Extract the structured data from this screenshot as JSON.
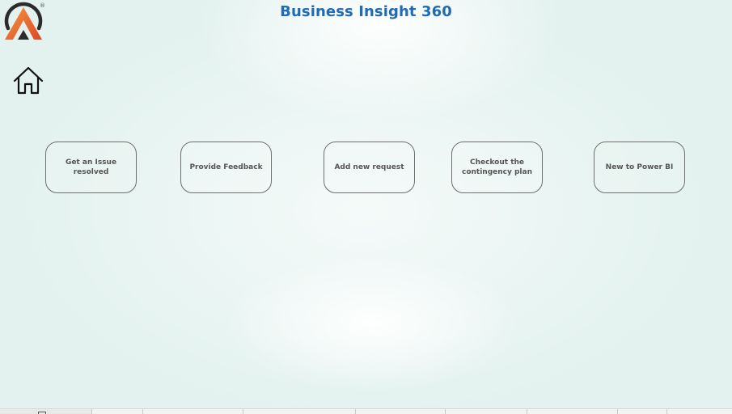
{
  "header": {
    "title": "Business Insight 360",
    "logo_icon": "atliq-logo-icon",
    "registered_mark": "®"
  },
  "nav": {
    "home_icon": "home-icon"
  },
  "actions": [
    {
      "label": "Get an Issue resolved"
    },
    {
      "label": "Provide Feedback"
    },
    {
      "label": "Add new request"
    },
    {
      "label": "Checkout the\ncontingency plan"
    },
    {
      "label": "New to Power BI"
    }
  ],
  "colors": {
    "title": "#1f6bb5",
    "logo_orange": "#e8652b",
    "logo_dark": "#2b2b2b",
    "background": "#e6f3f0",
    "button_border": "#6e6e6e",
    "button_text": "#555555"
  },
  "page_tabs": {
    "count": 8,
    "active_index": 0
  }
}
